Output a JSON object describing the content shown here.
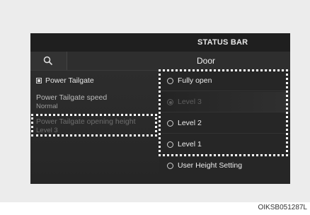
{
  "status_bar": {
    "label": "STATUS BAR"
  },
  "header": {
    "search_icon": "search-icon",
    "title": "Door"
  },
  "left_menu": {
    "power_tailgate": {
      "label": "Power Tailgate",
      "checked": true
    },
    "speed": {
      "label": "Power Tailgate speed",
      "value": "Normal"
    },
    "opening_height": {
      "label": "Power Tailgate opening height",
      "value": "Level 3"
    }
  },
  "options": [
    {
      "label": "Fully open",
      "selected": false
    },
    {
      "label": "Level 3",
      "selected": true
    },
    {
      "label": "Level 2",
      "selected": false
    },
    {
      "label": "Level 1",
      "selected": false
    },
    {
      "label": "User Height Setting",
      "selected": false
    }
  ],
  "caption": "OIKSB051287L"
}
